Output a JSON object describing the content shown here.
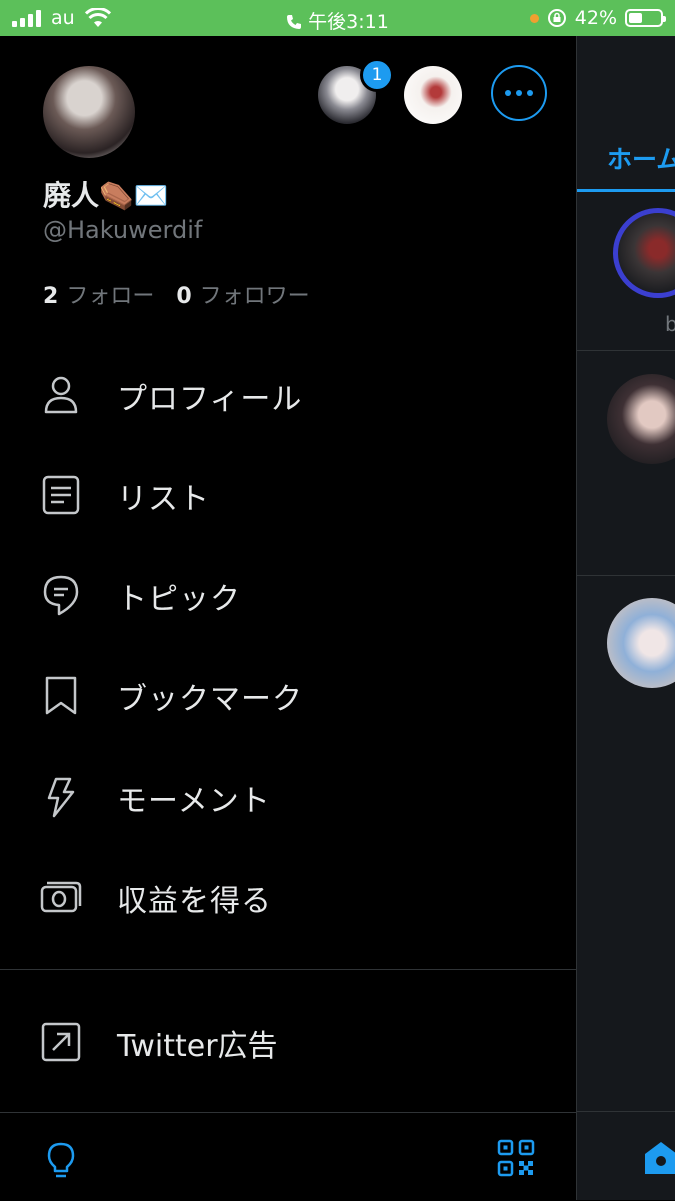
{
  "status_bar": {
    "carrier": "au",
    "time": "午後3:11",
    "battery_percent": "42%",
    "battery_level": 0.42,
    "background": "#5cc05a"
  },
  "drawer": {
    "profile": {
      "display_name": "廃人⚰️✉️",
      "handle": "@Hakuwerdif",
      "following_count": "2",
      "following_label": "フォロー",
      "followers_count": "0",
      "followers_label": "フォロワー"
    },
    "account_switcher": {
      "notification_badge": "1"
    },
    "menu": [
      {
        "label": "プロフィール",
        "icon": "person-icon"
      },
      {
        "label": "リスト",
        "icon": "list-icon"
      },
      {
        "label": "トピック",
        "icon": "topic-icon"
      },
      {
        "label": "ブックマーク",
        "icon": "bookmark-icon"
      },
      {
        "label": "モーメント",
        "icon": "lightning-icon"
      },
      {
        "label": "収益を得る",
        "icon": "money-icon"
      }
    ],
    "ads_item": {
      "label": "Twitter広告",
      "icon": "external-arrow-icon"
    },
    "accent_color": "#1d9bf0"
  },
  "timeline": {
    "tab_label": "ホーム",
    "fleet_text": "b"
  }
}
